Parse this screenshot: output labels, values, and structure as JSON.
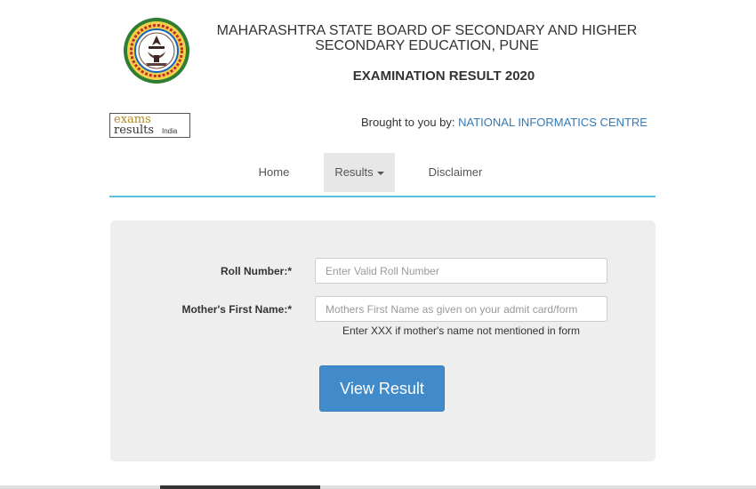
{
  "header": {
    "title_line1": "MAHARASHTRA STATE BOARD OF SECONDARY AND HIGHER",
    "title_line2": "SECONDARY EDUCATION, PUNE",
    "subtitle": "EXAMINATION RESULT 2020"
  },
  "brand": {
    "logo_line1": "exams",
    "logo_line2": "results",
    "logo_line3": "India",
    "brought_prefix": "Brought to you by:",
    "brought_link": "NATIONAL INFORMATICS CENTRE"
  },
  "nav": {
    "home": "Home",
    "results": "Results",
    "disclaimer": "Disclaimer"
  },
  "form": {
    "roll_label": "Roll Number:*",
    "roll_placeholder": "Enter Valid Roll Number",
    "roll_value": "",
    "mother_label": "Mother's First Name:*",
    "mother_placeholder": "Mothers First Name as given on your admit card/form",
    "mother_value": "",
    "hint": "Enter XXX if mother's name not mentioned in form",
    "submit_label": "View Result"
  },
  "colors": {
    "accent": "#428bca",
    "link": "#337ab7",
    "nav_underline": "#5bc0de",
    "panel_bg": "#eeeeee"
  }
}
